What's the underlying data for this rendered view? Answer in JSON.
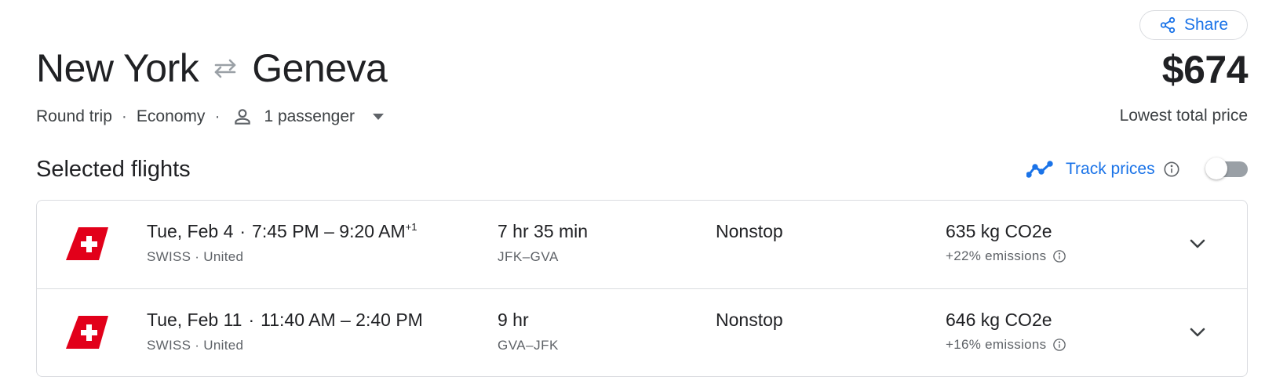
{
  "header": {
    "share_label": "Share",
    "origin": "New York",
    "destination": "Geneva",
    "trip_type": "Round trip",
    "cabin": "Economy",
    "passengers": "1 passenger",
    "separator": "·",
    "price": "$674",
    "price_note": "Lowest total price"
  },
  "section": {
    "title": "Selected flights",
    "track_label": "Track prices",
    "track_enabled": false
  },
  "flights": [
    {
      "date": "Tue, Feb 4",
      "dot": "·",
      "times": "7:45 PM – 9:20 AM",
      "day_offset": "+1",
      "airline": "SWISS · United",
      "duration": "7 hr 35 min",
      "airports": "JFK–GVA",
      "stops": "Nonstop",
      "co2": "635 kg CO2e",
      "emissions": "+22% emissions"
    },
    {
      "date": "Tue, Feb 11",
      "dot": "·",
      "times": "11:40 AM – 2:40 PM",
      "day_offset": "",
      "airline": "SWISS · United",
      "duration": "9 hr",
      "airports": "GVA–JFK",
      "stops": "Nonstop",
      "co2": "646 kg CO2e",
      "emissions": "+16% emissions"
    }
  ],
  "colors": {
    "accent": "#1a73e8",
    "swiss_red": "#e2001a",
    "toggle_off": "#9aa0a6"
  },
  "icons": {
    "share": "share-icon",
    "swap": "swap-arrows-icon",
    "person": "person-icon",
    "dropdown": "caret-down-icon",
    "trend": "trend-line-icon",
    "info": "info-icon",
    "airline_logo": "swiss-tail-logo",
    "expand": "chevron-down-icon"
  }
}
